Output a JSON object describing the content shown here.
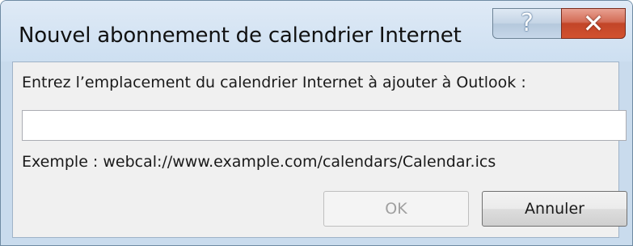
{
  "window": {
    "title": "Nouvel abonnement de calendrier Internet",
    "help_glyph": "?",
    "close_glyph": "✕"
  },
  "dialog": {
    "prompt": "Entrez l’emplacement du calendrier Internet à ajouter à Outlook :",
    "url_value": "",
    "example": "Exemple : webcal://www.example.com/calendars/Calendar.ics"
  },
  "buttons": {
    "ok_label": "OK",
    "ok_enabled": false,
    "cancel_label": "Annuler"
  },
  "colors": {
    "frame": "#c9dbed",
    "client": "#f0f0f0",
    "close_button": "#c24528"
  }
}
